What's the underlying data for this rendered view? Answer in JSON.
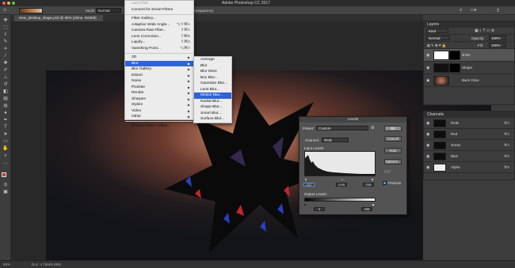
{
  "app": {
    "title": "Adobe Photoshop CC 2017",
    "options_bar": {
      "mode_label": "Mode:",
      "mode_value": "Normal",
      "opacity_label": "Opacity:",
      "opacity_value": "100%",
      "flow_label": "Transparency"
    },
    "document_tab": "New_desktop_shape.psd @ 85% (shine, RGB/8)",
    "status": {
      "zoom": "85%",
      "doc_size": "Doc: 4.75M/6.68M"
    }
  },
  "filter_menu": {
    "items": [
      {
        "label": "Last Filter",
        "shortcut": "",
        "submenu": false,
        "disabled": true
      },
      {
        "label": "Convert for Smart Filters",
        "shortcut": "",
        "submenu": false,
        "disabled": false
      },
      {
        "label": "Filter Gallery...",
        "shortcut": "",
        "submenu": false,
        "disabled": false
      },
      {
        "label": "Adaptive Wide Angle...",
        "shortcut": "⌥⇧⌘A",
        "submenu": false,
        "disabled": false
      },
      {
        "label": "Camera Raw Filter...",
        "shortcut": "⇧⌘A",
        "submenu": false,
        "disabled": false
      },
      {
        "label": "Lens Correction...",
        "shortcut": "⇧⌘R",
        "submenu": false,
        "disabled": false
      },
      {
        "label": "Liquify...",
        "shortcut": "⇧⌘X",
        "submenu": false,
        "disabled": false
      },
      {
        "label": "Vanishing Point...",
        "shortcut": "⌥⌘V",
        "submenu": false,
        "disabled": false
      },
      {
        "label": "3D",
        "shortcut": "",
        "submenu": true,
        "disabled": false
      },
      {
        "label": "Blur",
        "shortcut": "",
        "submenu": true,
        "disabled": false,
        "selected": true
      },
      {
        "label": "Blur Gallery",
        "shortcut": "",
        "submenu": true,
        "disabled": false
      },
      {
        "label": "Distort",
        "shortcut": "",
        "submenu": true,
        "disabled": false
      },
      {
        "label": "Noise",
        "shortcut": "",
        "submenu": true,
        "disabled": false
      },
      {
        "label": "Pixelate",
        "shortcut": "",
        "submenu": true,
        "disabled": false
      },
      {
        "label": "Render",
        "shortcut": "",
        "submenu": true,
        "disabled": false
      },
      {
        "label": "Sharpen",
        "shortcut": "",
        "submenu": true,
        "disabled": false
      },
      {
        "label": "Stylize",
        "shortcut": "",
        "submenu": true,
        "disabled": false
      },
      {
        "label": "Video",
        "shortcut": "",
        "submenu": true,
        "disabled": false
      },
      {
        "label": "Other",
        "shortcut": "",
        "submenu": true,
        "disabled": false
      },
      {
        "label": "Browse Filters Online...",
        "shortcut": "",
        "submenu": false,
        "disabled": false
      }
    ]
  },
  "blur_submenu": {
    "items": [
      "Average",
      "Blur",
      "Blur More",
      "Box Blur...",
      "Gaussian Blur...",
      "Lens Blur...",
      "Motion Blur...",
      "Radial Blur...",
      "Shape Blur...",
      "Smart Blur...",
      "Surface Blur..."
    ],
    "selected": "Motion Blur..."
  },
  "layers_panel": {
    "title": "Layers",
    "kind_label": "Kind",
    "blend_mode": "Normal",
    "opacity_label": "Opacity:",
    "opacity_value": "100%",
    "fill_label": "Fill:",
    "fill_value": "100%",
    "layers": [
      {
        "name": "shine",
        "selected": true
      },
      {
        "name": "Shape",
        "selected": false
      },
      {
        "name": "Back Glow",
        "selected": false
      }
    ]
  },
  "channels_panel": {
    "title": "Channels",
    "channels": [
      {
        "name": "RGB",
        "shortcut": "⌘2"
      },
      {
        "name": "Red",
        "shortcut": "⌘3"
      },
      {
        "name": "Green",
        "shortcut": "⌘4"
      },
      {
        "name": "Blue",
        "shortcut": "⌘5"
      },
      {
        "name": "Alpha",
        "shortcut": "⌘6"
      }
    ]
  },
  "levels_dialog": {
    "title": "Levels",
    "preset_label": "Preset:",
    "preset_value": "Custom",
    "channel_label": "Channel:",
    "channel_value": "RGB",
    "input_levels_label": "Input Levels:",
    "input_black": "107",
    "input_gamma": "1.00",
    "input_white": "216",
    "output_levels_label": "Output Levels:",
    "output_black": "0",
    "output_white": "255",
    "buttons": {
      "ok": "OK",
      "cancel": "Cancel",
      "auto": "Auto",
      "options": "Options..."
    },
    "preview_label": "Preview",
    "preview_checked": true
  }
}
